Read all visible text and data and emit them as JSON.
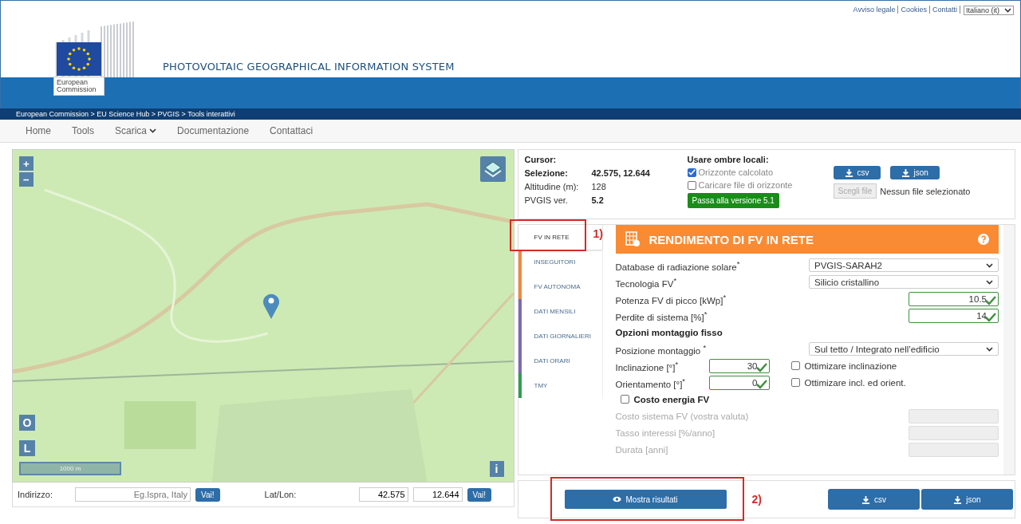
{
  "top_links": [
    "Avviso legale",
    "Cookies",
    "Contatti"
  ],
  "language": "Italiano (it)",
  "logo": {
    "caption": "European Commission"
  },
  "site_title": "PHOTOVOLTAIC GEOGRAPHICAL INFORMATION SYSTEM",
  "breadcrumb": "European Commission > EU Science Hub > PVGIS > Tools interattivi",
  "nav": [
    {
      "label": "Home",
      "dropdown": false
    },
    {
      "label": "Tools",
      "dropdown": false
    },
    {
      "label": "Scarica",
      "dropdown": true
    },
    {
      "label": "Documentazione",
      "dropdown": false
    },
    {
      "label": "Contattaci",
      "dropdown": false
    }
  ],
  "map": {
    "controls": {
      "zoom_in": "+",
      "zoom_out": "−",
      "o": "O",
      "l": "L",
      "info": "i"
    },
    "scale": "1000 m"
  },
  "address": {
    "label": "Indirizzo:",
    "placeholder": "Eg.Ispra, Italy",
    "go": "Vai!",
    "latlon_label": "Lat/Lon:",
    "lat": "42.575",
    "lon": "12.644",
    "go2": "Vai!"
  },
  "info": {
    "cursor_label": "Cursor:",
    "selection_label": "Selezione:",
    "selection": "42.575, 12.644",
    "altitude_label": "Altitudine (m):",
    "altitude": "128",
    "version_label": "PVGIS ver.",
    "version": "5.2",
    "shadows_title": "Usare ombre locali:",
    "horizon": {
      "label": "Orizzonte calcolato",
      "checked": true
    },
    "horizon_file": {
      "label": "Caricare file di orizzonte",
      "checked": false
    },
    "switch_button": "Passa alla versione 5.1",
    "csv": "csv",
    "json": "json",
    "choose_file": "Scegli file",
    "no_file": "Nessun file selezionato"
  },
  "tabs": [
    {
      "label": "FV IN RETE",
      "selected": true
    },
    {
      "label": "INSEGUITORI",
      "selected": false,
      "color": "#f0883a"
    },
    {
      "label": "FV AUTONOMA",
      "selected": false,
      "color": "#f0883a"
    },
    {
      "label": "DATI MENSILI",
      "selected": false,
      "color": "#7a6bb0"
    },
    {
      "label": "DATI GIORNALIERI",
      "selected": false,
      "color": "#7a6bb0"
    },
    {
      "label": "DATI ORARI",
      "selected": false,
      "color": "#7a6bb0"
    },
    {
      "label": "TMY",
      "selected": false,
      "color": "#2f9e4f"
    }
  ],
  "form": {
    "title": "RENDIMENTO DI FV IN RETE",
    "rows": [
      {
        "kind": "select",
        "label": "Database di radiazione solare$^{*}$",
        "value": "PVGIS-SARAH2"
      },
      {
        "kind": "select",
        "label": "Tecnologia FV$^{*}$",
        "value": "Silicio cristallino"
      },
      {
        "kind": "number",
        "label": "Potenza FV di picco [kWp]$^{*}$",
        "value": "10.5"
      },
      {
        "kind": "number",
        "label": "Perdite di sistema [%]$^{*}$",
        "value": "14"
      },
      {
        "kind": "heading",
        "label": "Opzioni montaggio fisso"
      },
      {
        "kind": "select",
        "label": "Posizione montaggio $^{*}$",
        "value": "Sul tetto / Integrato nell’edificio"
      },
      {
        "kind": "angle",
        "label": "Inclinazione [°]$^{*}$",
        "value": "30",
        "option": {
          "label": "Ottimizare inclinazione",
          "checked": false
        }
      },
      {
        "kind": "angle",
        "label": "Orientamento [°]$^{*}$",
        "value": "0",
        "option": {
          "label": "Ottimizare incl. ed orient.",
          "checked": false
        }
      },
      {
        "kind": "checkbox",
        "label": "Costo energia FV",
        "checked": false
      },
      {
        "kind": "disabled",
        "label": "Costo sistema FV (vostra valuta)"
      },
      {
        "kind": "disabled",
        "label": "Tasso interessi [%/anno]"
      },
      {
        "kind": "disabled",
        "label": "Durata [anni]"
      }
    ]
  },
  "results": {
    "show": "Mostra risultati",
    "csv": "csv",
    "json": "json"
  },
  "annotations": [
    "1)",
    "2)"
  ]
}
